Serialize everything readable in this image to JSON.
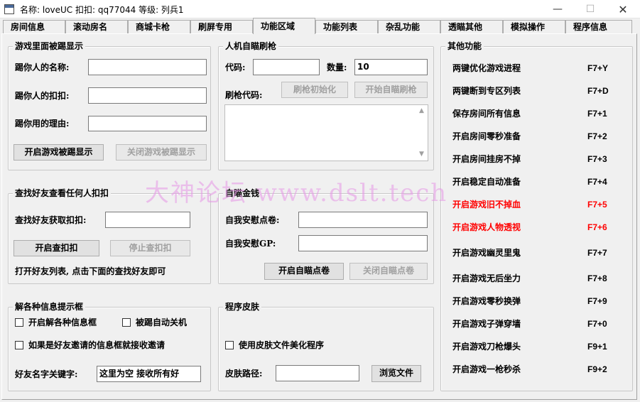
{
  "window": {
    "title": "名称: loveUC 扣扣: qq77044 等级: 列兵1",
    "min_icon": "minimize-icon",
    "max_icon": "maximize-icon",
    "close_icon": "close-icon"
  },
  "tabs": [
    {
      "label": "房间信息"
    },
    {
      "label": "滚动房名"
    },
    {
      "label": "商城卡枪"
    },
    {
      "label": "刷屏专用"
    },
    {
      "label": "功能区域",
      "active": true
    },
    {
      "label": "功能列表"
    },
    {
      "label": "杂乱功能"
    },
    {
      "label": "透瞄其他"
    },
    {
      "label": "模拟操作"
    },
    {
      "label": "程序信息"
    }
  ],
  "kicked": {
    "title": "游戏里面被踢显示",
    "name_label": "踢你人的名称:",
    "name_value": "",
    "qq_label": "踢你人的扣扣:",
    "qq_value": "",
    "reason_label": "踢你用的理由:",
    "reason_value": "",
    "enable_btn": "开启游戏被踢显示",
    "disable_btn": "关闭游戏被踢显示"
  },
  "bot": {
    "title": "人机自瞄刷枪",
    "code_label": "代码:",
    "code_value": "",
    "count_label": "数量:",
    "count_value": "10",
    "gun_code_label": "刷枪代码:",
    "init_btn": "刷枪初始化",
    "start_btn": "开始自瞄刷枪"
  },
  "friend": {
    "title": "查找好友查看任何人扣扣",
    "find_label": "查找好友获取扣扣:",
    "find_value": "",
    "start_btn": "开启查扣扣",
    "stop_btn": "停止查扣扣",
    "hint": "打开好友列表, 点击下面的查找好友即可"
  },
  "money": {
    "title": "自瞄金钱",
    "points_label": "自我安慰点卷:",
    "points_value": "",
    "gp_label": "自我安慰GP:",
    "gp_value": "",
    "enable_btn": "开启自瞄点卷",
    "disable_btn": "关闭自瞄点卷"
  },
  "info": {
    "title": "解各种信息提示框",
    "chk_info": "开启解各种信息框",
    "chk_autoclose": "被踢自动关机",
    "chk_friend": "如果是好友邀请的信息框就接收邀请",
    "keyword_label": "好友名字关键字:",
    "keyword_value": "这里为空 接收所有好"
  },
  "skin": {
    "title": "程序皮肤",
    "chk_skin": "使用皮肤文件美化程序",
    "path_label": "皮肤路径:",
    "path_value": "",
    "browse_btn": "浏览文件"
  },
  "other": {
    "title": "其他功能",
    "items": [
      {
        "name": "两键优化游戏进程",
        "key": "F7+Y",
        "red": false
      },
      {
        "name": "两键断到专区列表",
        "key": "F7+D",
        "red": false
      },
      {
        "name": "保存房间所有信息",
        "key": "F7+1",
        "red": false
      },
      {
        "name": "开启房间零秒准备",
        "key": "F7+2",
        "red": false
      },
      {
        "name": "开启房间挂房不掉",
        "key": "F7+3",
        "red": false
      },
      {
        "name": "开启稳定自动准备",
        "key": "F7+4",
        "red": false
      },
      {
        "name": "开启游戏旧不掉血",
        "key": "F7+5",
        "red": true
      },
      {
        "name": "开启游戏人物透视",
        "key": "F7+6",
        "red": true
      },
      {
        "name": "开启游戏幽灵里鬼",
        "key": "F7+7",
        "red": false
      },
      {
        "name": "开启游戏无后坐力",
        "key": "F7+8",
        "red": false
      },
      {
        "name": "开启游戏零秒换弹",
        "key": "F7+9",
        "red": false
      },
      {
        "name": "开启游戏子弹穿墙",
        "key": "F7+0",
        "red": false
      },
      {
        "name": "开启游戏刀枪爆头",
        "key": "F9+1",
        "red": false
      },
      {
        "name": "开启游戏一枪秒杀",
        "key": "F9+2",
        "red": false
      }
    ]
  },
  "watermark": "大神论坛  www.dslt.tech",
  "colors": {
    "highlight": "#ff0000",
    "watermark": "#e696e6"
  }
}
